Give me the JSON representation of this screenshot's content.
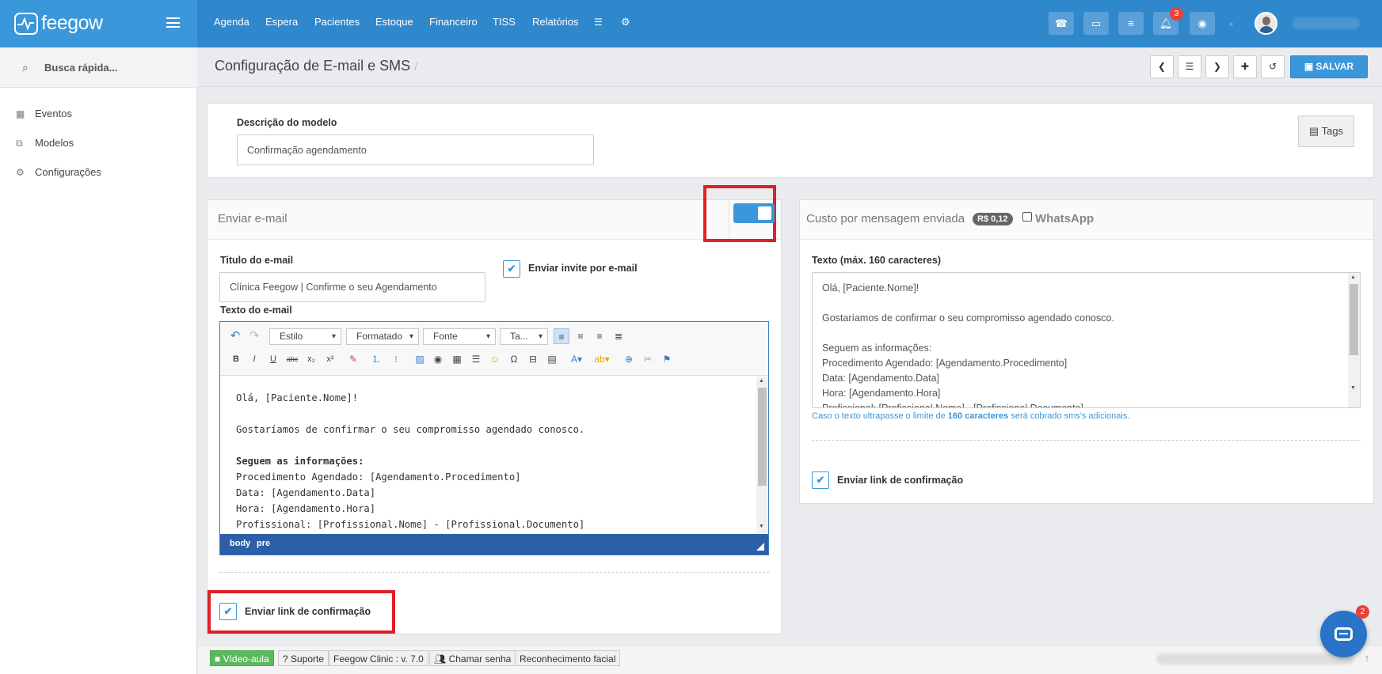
{
  "app": {
    "brand": "feegow",
    "brand_color": "#2f87cc"
  },
  "nav": [
    "Agenda",
    "Espera",
    "Pacientes",
    "Estoque",
    "Financeiro",
    "TISS",
    "Relatórios"
  ],
  "topbar": {
    "notification_count": "3",
    "chat_badge": "2"
  },
  "sidebar": {
    "search_placeholder": "Busca rápida...",
    "items": [
      {
        "label": "Eventos",
        "icon": "calendar-icon"
      },
      {
        "label": "Modelos",
        "icon": "copy-icon"
      },
      {
        "label": "Configurações",
        "icon": "cogs-icon"
      }
    ]
  },
  "page": {
    "title": "Configuração de E-mail e SMS",
    "breadcrumb_sep": "/",
    "save_label": "SALVAR"
  },
  "model": {
    "description_label": "Descrição do modelo",
    "description_value": "Confirmação agendamento",
    "tags_label": "Tags"
  },
  "email": {
    "header": "Enviar e-mail",
    "toggle_on": true,
    "title_label": "Titulo do e-mail",
    "title_value": "Clínica Feegow | Confirme o seu Agendamento",
    "invite_label": "Enviar invite por e-mail",
    "text_label": "Texto do e-mail",
    "toolbar": {
      "style": "Estilo",
      "format": "Formatado",
      "font": "Fonte",
      "size": "Ta..."
    },
    "body_lines": [
      "Olá, [Paciente.Nome]!",
      "",
      "Gostaríamos de confirmar o seu compromisso agendado conosco.",
      "",
      "Seguem as informações:",
      "Procedimento Agendado: [Agendamento.Procedimento]",
      "Data: [Agendamento.Data]",
      "Hora: [Agendamento.Hora]",
      "Profissional: [Profissional.Nome] - [Profissional.Documento]"
    ],
    "path": [
      "body",
      "pre"
    ],
    "confirm_link_label": "Enviar link de confirmação"
  },
  "sms": {
    "header": "Custo por mensagem enviada",
    "price": "R$ 0,12",
    "whatsapp_label": "WhatsApp",
    "text_label": "Texto (máx. 160 caracteres)",
    "body_lines": [
      "Olá, [Paciente.Nome]!",
      "",
      "Gostaríamos de confirmar o seu compromisso agendado conosco.",
      "",
      "Seguem as informações:",
      "Procedimento Agendado: [Agendamento.Procedimento]",
      "Data: [Agendamento.Data]",
      "Hora: [Agendamento.Hora]",
      "Profissional: [Profissional.Nome] - [Profissional.Documento]"
    ],
    "hint_pre": "Caso o texto ultrapasse o limite de ",
    "hint_bold": "160 caracteres",
    "hint_post": " será cobrado sms's adicionais.",
    "confirm_link_label": "Enviar link de confirmação"
  },
  "footer": {
    "video": "Vídeo-aula",
    "support": "Suporte",
    "version": "Feegow Clinic : v. 7.0",
    "call_password": "Chamar senha",
    "face": "Reconhecimento facial"
  }
}
